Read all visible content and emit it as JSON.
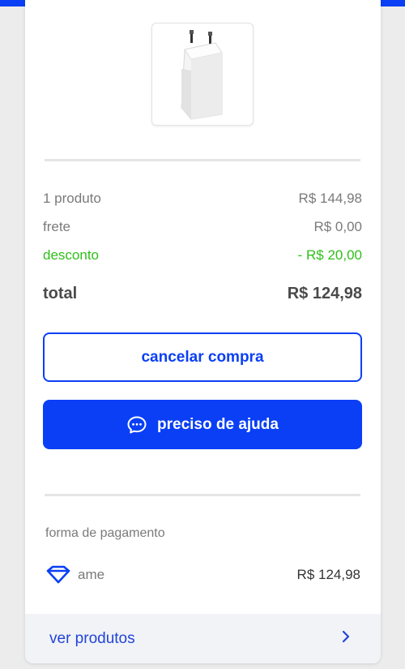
{
  "summary": {
    "items_label": "1 produto",
    "items_value": "R$ 144,98",
    "shipping_label": "frete",
    "shipping_value": "R$ 0,00",
    "discount_label": "desconto",
    "discount_value": "- R$ 20,00",
    "total_label": "total",
    "total_value": "R$ 124,98"
  },
  "actions": {
    "cancel_label": "cancelar compra",
    "help_label": "preciso de ajuda"
  },
  "payment": {
    "section_label": "forma de pagamento",
    "method_name": "ame",
    "method_value": "R$ 124,98"
  },
  "footer": {
    "link_label": "ver produtos"
  },
  "colors": {
    "brand_blue": "#0a3ff5",
    "discount_green": "#2fbf1a"
  },
  "icons": {
    "help": "chat-bubble-icon",
    "payment": "ame-heart-diamond-icon",
    "footer": "chevron-right-icon"
  }
}
